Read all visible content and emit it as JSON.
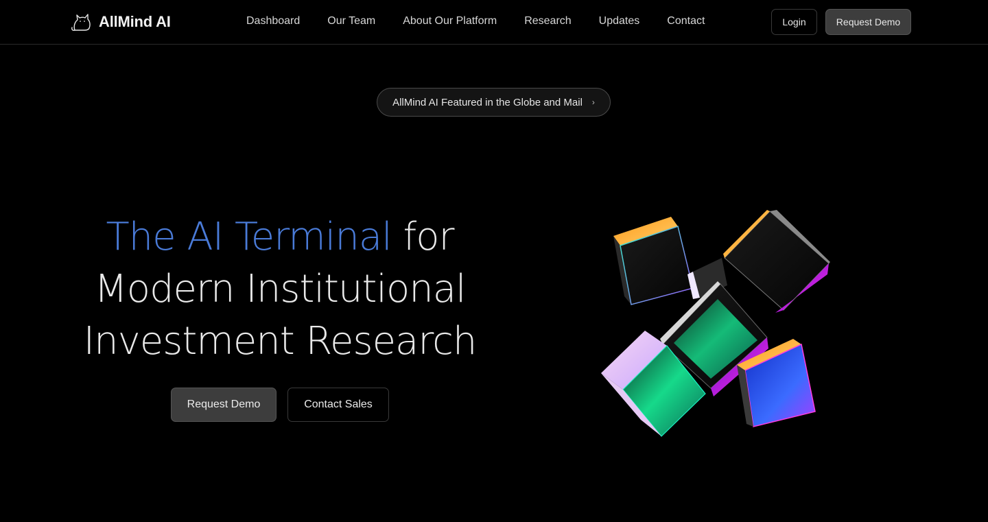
{
  "header": {
    "brand": "AllMind AI",
    "logo_icon": "cat-icon",
    "nav": [
      {
        "label": "Dashboard"
      },
      {
        "label": "Our Team"
      },
      {
        "label": "About Our Platform"
      },
      {
        "label": "Research"
      },
      {
        "label": "Updates"
      },
      {
        "label": "Contact"
      }
    ],
    "login_label": "Login",
    "request_demo_label": "Request Demo"
  },
  "announcement": {
    "text": "AllMind AI Featured in the Globe and Mail",
    "chevron": "›"
  },
  "hero": {
    "title_accent": "The AI Terminal",
    "title_rest_1": " for",
    "title_line_2": "Modern Institutional",
    "title_line_3": "Investment Research",
    "primary_cta": "Request Demo",
    "secondary_cta": "Contact Sales"
  },
  "colors": {
    "background": "#000000",
    "accent_blue": "#4a7bd8",
    "button_fill": "#3d3d3d"
  }
}
